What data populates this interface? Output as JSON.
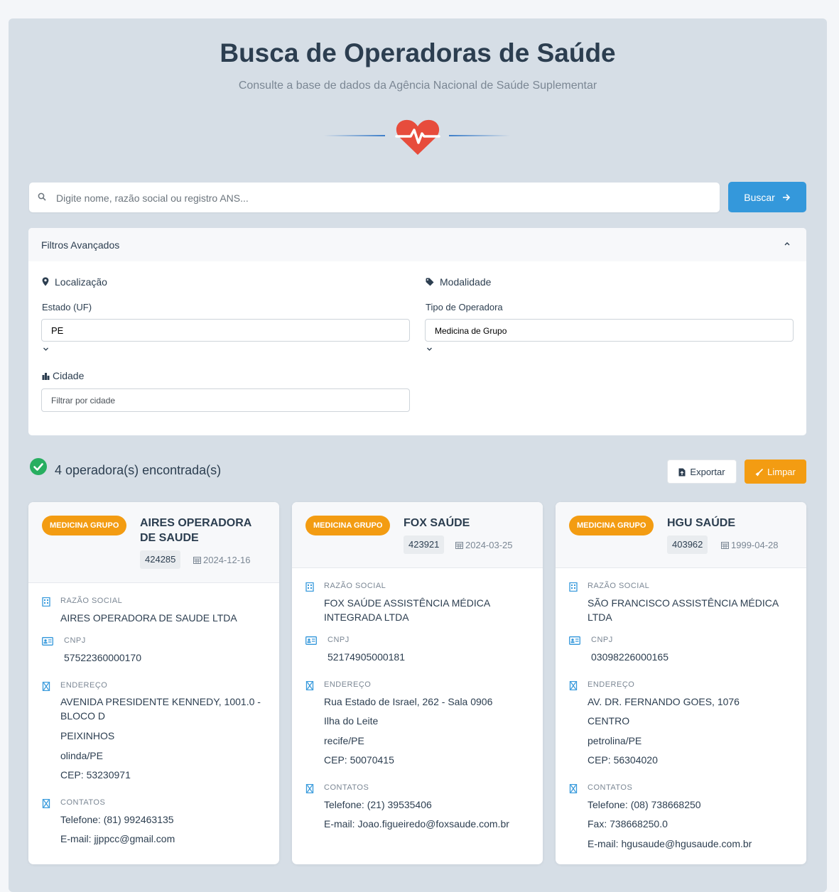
{
  "header": {
    "title": "Busca de Operadoras de Saúde",
    "subtitle": "Consulte a base de dados da Agência Nacional de Saúde Suplementar",
    "icon": "heartbeat-icon",
    "accent_color": "#e74c3c"
  },
  "search": {
    "placeholder": "Digite nome, razão social ou registro ANS...",
    "value": "",
    "button_label": "Buscar",
    "button_color": "#3498db"
  },
  "filters": {
    "title": "Filtros Avançados",
    "location_label": "Localização",
    "state_label": "Estado (UF)",
    "state_value": "PE",
    "city_label": "Cidade",
    "city_placeholder": "Filtrar por cidade",
    "modality_label": "Modalidade",
    "type_label": "Tipo de Operadora",
    "type_value": "Medicina de Grupo"
  },
  "results": {
    "count_text": "4 operadora(s) encontrada(s)",
    "export_label": "Exportar",
    "clear_label": "Limpar",
    "clear_color": "#f39c12"
  },
  "field_labels": {
    "razao": "RAZÃO SOCIAL",
    "cnpj": "CNPJ",
    "endereco": "ENDEREÇO",
    "contatos": "CONTATOS"
  },
  "cards": [
    {
      "badge": "MEDICINA GRUPO",
      "name": "AIRES OPERADORA DE SAUDE",
      "registro": "424285",
      "date": "2024-12-16",
      "razao": "AIRES OPERADORA DE SAUDE LTDA",
      "cnpj": "57522360000170",
      "address": [
        "AVENIDA PRESIDENTE KENNEDY, 1001.0 - BLOCO D",
        "PEIXINHOS",
        "olinda/PE",
        "CEP: 53230971"
      ],
      "contacts": [
        "Telefone: (81) 992463135",
        "E-mail: jjppcc@gmail.com"
      ]
    },
    {
      "badge": "MEDICINA GRUPO",
      "name": "FOX SAÚDE",
      "registro": "423921",
      "date": "2024-03-25",
      "razao": "FOX SAÚDE ASSISTÊNCIA MÉDICA INTEGRADA LTDA",
      "cnpj": "52174905000181",
      "address": [
        "Rua Estado de Israel, 262 - Sala 0906",
        "Ilha do Leite",
        "recife/PE",
        "CEP: 50070415"
      ],
      "contacts": [
        "Telefone: (21) 39535406",
        "E-mail: Joao.figueiredo@foxsaude.com.br"
      ]
    },
    {
      "badge": "MEDICINA GRUPO",
      "name": "HGU SAÚDE",
      "registro": "403962",
      "date": "1999-04-28",
      "razao": "SÃO FRANCISCO ASSISTÊNCIA MÉDICA LTDA",
      "cnpj": "03098226000165",
      "address": [
        "AV. DR. FERNANDO GOES, 1076",
        "CENTRO",
        "petrolina/PE",
        "CEP: 56304020"
      ],
      "contacts": [
        "Telefone: (08) 738668250",
        "Fax: 738668250.0",
        "E-mail: hgusaude@hgusaude.com.br"
      ]
    }
  ]
}
